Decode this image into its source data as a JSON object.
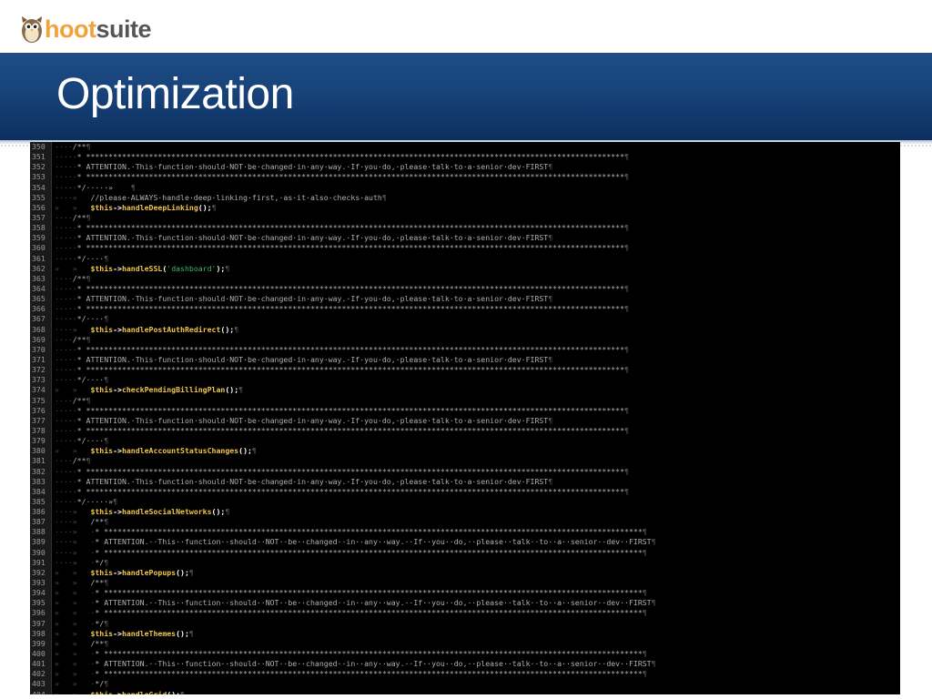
{
  "logo": {
    "hoot": "hoot",
    "suite": "suite"
  },
  "slide": {
    "title": "Optimization"
  },
  "colors": {
    "title_band": "#17427a",
    "code_bg": "#000000",
    "keyword": "#f0c64a",
    "string": "#3fb56b",
    "comment": "#b0b0b0",
    "logo_orange": "#f2a23a"
  },
  "code": {
    "lines": [
      {
        "n": "350",
        "kind": "open",
        "ind": "····"
      },
      {
        "n": "351",
        "kind": "stars",
        "ind": "·····"
      },
      {
        "n": "352",
        "kind": "attention",
        "ind": "·····"
      },
      {
        "n": "353",
        "kind": "stars",
        "ind": "·····"
      },
      {
        "n": "354",
        "kind": "close_tab",
        "ind": "·····"
      },
      {
        "n": "355",
        "kind": "comment_text",
        "ind": "····»   ",
        "text": "//please·ALWAYS·handle·deep·linking·first,·as·it·also·checks·auth"
      },
      {
        "n": "356",
        "kind": "call",
        "ind": "»   »   ",
        "fn": "handleDeepLinking",
        "arg": ""
      },
      {
        "n": "357",
        "kind": "open",
        "ind": "····"
      },
      {
        "n": "358",
        "kind": "stars",
        "ind": "·····"
      },
      {
        "n": "359",
        "kind": "attention",
        "ind": "·····"
      },
      {
        "n": "360",
        "kind": "stars",
        "ind": "·····"
      },
      {
        "n": "361",
        "kind": "close",
        "ind": "·····"
      },
      {
        "n": "362",
        "kind": "call",
        "ind": "»   »   ",
        "fn": "handleSSL",
        "arg": "'dashboard'"
      },
      {
        "n": "363",
        "kind": "open",
        "ind": "····"
      },
      {
        "n": "364",
        "kind": "stars",
        "ind": "·····"
      },
      {
        "n": "365",
        "kind": "attention",
        "ind": "·····"
      },
      {
        "n": "366",
        "kind": "stars",
        "ind": "·····"
      },
      {
        "n": "367",
        "kind": "close",
        "ind": "·····"
      },
      {
        "n": "368",
        "kind": "call",
        "ind": "····»   ",
        "fn": "handlePostAuthRedirect",
        "arg": ""
      },
      {
        "n": "369",
        "kind": "open",
        "ind": "····"
      },
      {
        "n": "370",
        "kind": "stars",
        "ind": "·····"
      },
      {
        "n": "371",
        "kind": "attention",
        "ind": "·····"
      },
      {
        "n": "372",
        "kind": "stars",
        "ind": "·····"
      },
      {
        "n": "373",
        "kind": "close",
        "ind": "·····"
      },
      {
        "n": "374",
        "kind": "call",
        "ind": "»   »   ",
        "fn": "checkPendingBillingPlan",
        "arg": ""
      },
      {
        "n": "375",
        "kind": "open",
        "ind": "····"
      },
      {
        "n": "376",
        "kind": "stars",
        "ind": "·····"
      },
      {
        "n": "377",
        "kind": "attention",
        "ind": "·····"
      },
      {
        "n": "378",
        "kind": "stars",
        "ind": "·····"
      },
      {
        "n": "379",
        "kind": "close",
        "ind": "·····"
      },
      {
        "n": "380",
        "kind": "call",
        "ind": "»   »   ",
        "fn": "handleAccountStatusChanges",
        "arg": ""
      },
      {
        "n": "381",
        "kind": "open",
        "ind": "····"
      },
      {
        "n": "382",
        "kind": "stars",
        "ind": "·····"
      },
      {
        "n": "383",
        "kind": "attention",
        "ind": "·····"
      },
      {
        "n": "384",
        "kind": "stars",
        "ind": "·····"
      },
      {
        "n": "385",
        "kind": "close_tab2",
        "ind": "·····"
      },
      {
        "n": "386",
        "kind": "call",
        "ind": "····»   ",
        "fn": "handleSocialNetworks",
        "arg": ""
      },
      {
        "n": "387",
        "kind": "open2",
        "ind": "····»   "
      },
      {
        "n": "388",
        "kind": "stars2",
        "ind": "····»   ·"
      },
      {
        "n": "389",
        "kind": "attention2",
        "ind": "····»   ·"
      },
      {
        "n": "390",
        "kind": "stars2",
        "ind": "····»   ·"
      },
      {
        "n": "391",
        "kind": "close2",
        "ind": "····»   ·"
      },
      {
        "n": "392",
        "kind": "call",
        "ind": "»   »   ",
        "fn": "handlePopups",
        "arg": ""
      },
      {
        "n": "393",
        "kind": "open2",
        "ind": "»   »   "
      },
      {
        "n": "394",
        "kind": "stars2",
        "ind": "»   »   ·"
      },
      {
        "n": "395",
        "kind": "attention2",
        "ind": "»   »   ·"
      },
      {
        "n": "396",
        "kind": "stars2",
        "ind": "»   »   ·"
      },
      {
        "n": "397",
        "kind": "close2",
        "ind": "»   »   ·"
      },
      {
        "n": "398",
        "kind": "call",
        "ind": "»   »   ",
        "fn": "handleThemes",
        "arg": ""
      },
      {
        "n": "399",
        "kind": "open2",
        "ind": "»   »   "
      },
      {
        "n": "400",
        "kind": "stars2",
        "ind": "»   »   ·"
      },
      {
        "n": "401",
        "kind": "attention2",
        "ind": "»   »   ·"
      },
      {
        "n": "402",
        "kind": "stars2",
        "ind": "»   »   ·"
      },
      {
        "n": "403",
        "kind": "close2",
        "ind": "»   »   ·"
      },
      {
        "n": "404",
        "kind": "call",
        "ind": "»   »   ",
        "fn": "handleGrid",
        "arg": ""
      }
    ],
    "tokens": {
      "open": "/**",
      "stars_row": "* ************************************************************************************************************************",
      "stars_row2": "* ************************************************************************************************************************",
      "attention": "* ATTENTION.·This·function·should·NOT·be·changed·in·any·way.·If·you·do,·please·talk·to·a·senior·dev·FIRST",
      "attention2": "* ATTENTION.··This··function··should··NOT··be··changed··in··any··way.··If··you··do,··please··talk··to··a··senior··dev··FIRST",
      "close": "*/····",
      "close_tab": "*/·····»    ",
      "close_tab2": "*/·····»",
      "close2": "*/",
      "this": "$this",
      "arrow": "->",
      "pilcrow": "¶"
    }
  }
}
